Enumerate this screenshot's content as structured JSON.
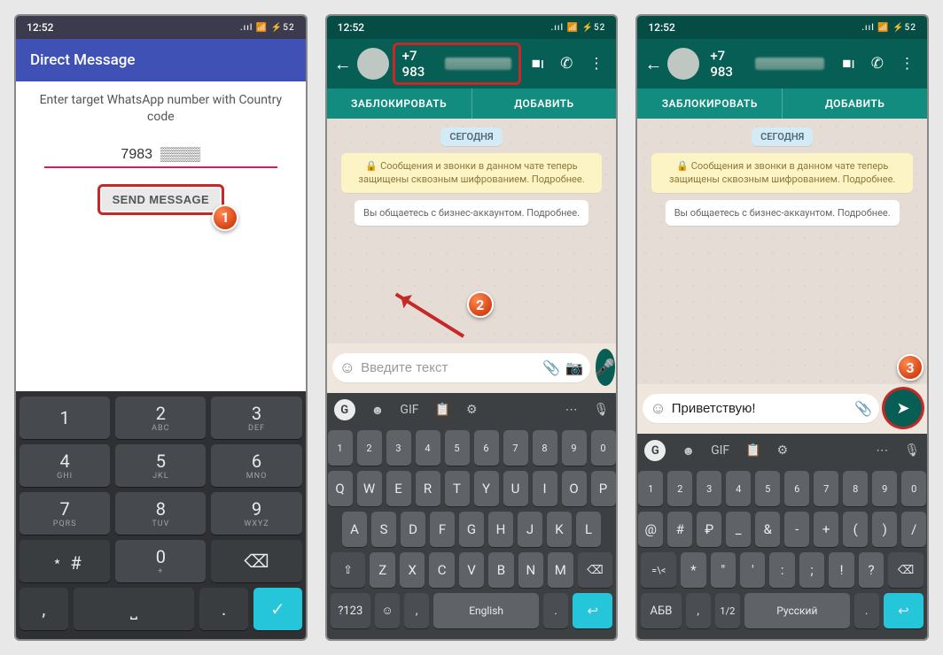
{
  "status": {
    "time": "12:52",
    "battery": "52"
  },
  "dm": {
    "title": "Direct Message",
    "instruction": "Enter target WhatsApp number with Country code",
    "phone_prefix": "7983",
    "send_label": "SEND MESSAGE"
  },
  "wa": {
    "contact": "+7 983",
    "block": "ЗАБЛОКИРОВАТЬ",
    "add": "ДОБАВИТЬ",
    "today": "СЕГОДНЯ",
    "encryption": "Сообщения и звонки в данном чате теперь защищены сквозным шифрованием. Подробнее.",
    "business": "Вы общаетесь с бизнес-аккаунтом. Подробнее.",
    "placeholder": "Введите текст",
    "typed": "Приветствую!"
  },
  "kbd": {
    "google": "G",
    "lang_en": "English",
    "lang_ru": "Русский",
    "sym": "?123",
    "abv": "АБВ",
    "sugg": [
      "GIF"
    ],
    "qwerty_rows": [
      [
        "Q",
        "W",
        "E",
        "R",
        "T",
        "Y",
        "U",
        "I",
        "O",
        "P"
      ],
      [
        "A",
        "S",
        "D",
        "F",
        "G",
        "H",
        "J",
        "K",
        "L"
      ],
      [
        "Z",
        "X",
        "C",
        "V",
        "B",
        "N",
        "M"
      ]
    ],
    "num_row": [
      "1",
      "2",
      "3",
      "4",
      "5",
      "6",
      "7",
      "8",
      "9",
      "0"
    ],
    "sym_rows": [
      [
        "@",
        "#",
        "₽",
        "_",
        "&",
        "-",
        "+",
        "(",
        ")",
        "/"
      ],
      [
        "*",
        "\"",
        "'",
        ":",
        ";",
        "!",
        "?"
      ]
    ],
    "numpad": [
      [
        {
          "d": "1",
          "s": ""
        },
        {
          "d": "2",
          "s": "ABC"
        },
        {
          "d": "3",
          "s": "DEF"
        }
      ],
      [
        {
          "d": "4",
          "s": "GHI"
        },
        {
          "d": "5",
          "s": "JKL"
        },
        {
          "d": "6",
          "s": "MNO"
        }
      ],
      [
        {
          "d": "7",
          "s": "PQRS"
        },
        {
          "d": "8",
          "s": "TUV"
        },
        {
          "d": "9",
          "s": "WXYZ"
        }
      ],
      [
        {
          "d": "﹡ #",
          "s": ""
        },
        {
          "d": "0",
          "s": "+"
        }
      ]
    ],
    "sym_toggle": "=\\<",
    "one_two": "1/2"
  },
  "steps": {
    "one": "1",
    "two": "2",
    "three": "3"
  }
}
